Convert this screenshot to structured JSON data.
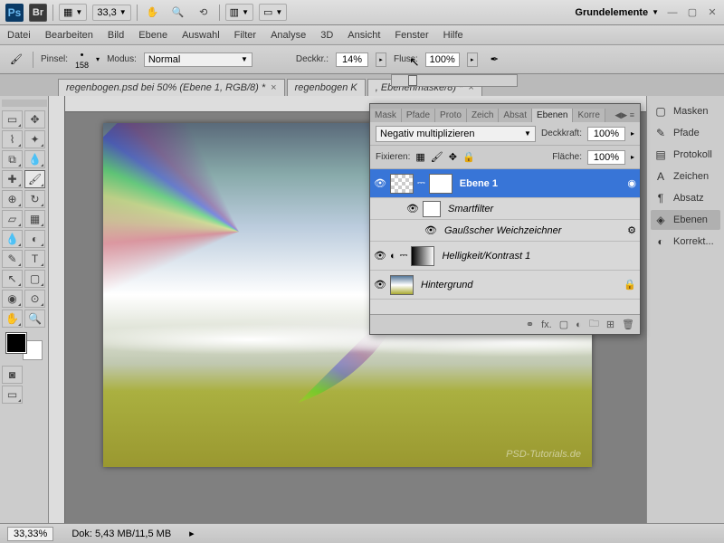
{
  "topbar": {
    "ps": "Ps",
    "br": "Br",
    "zoom_dd": "33,3",
    "workspace": "Grundelemente"
  },
  "menu": [
    "Datei",
    "Bearbeiten",
    "Bild",
    "Ebene",
    "Auswahl",
    "Filter",
    "Analyse",
    "3D",
    "Ansicht",
    "Fenster",
    "Hilfe"
  ],
  "options": {
    "brush_label": "Pinsel:",
    "brush_size": "158",
    "mode_label": "Modus:",
    "mode_value": "Normal",
    "opacity_label": "Deckkr.:",
    "opacity_value": "14%",
    "flow_label": "Fluss:",
    "flow_value": "100%"
  },
  "tabs": [
    {
      "title": "regenbogen.psd bei 50% (Ebene 1, RGB/8) *"
    },
    {
      "title": "regenbogen K"
    },
    {
      "title": ", Ebenenmaske/8) *"
    }
  ],
  "panel": {
    "tabs": [
      "Mask",
      "Pfade",
      "Proto",
      "Zeich",
      "Absat",
      "Ebenen",
      "Korre"
    ],
    "active_tab": 5,
    "blend_label": "",
    "blend_mode": "Negativ multiplizieren",
    "opacity_label": "Deckkraft:",
    "opacity_value": "100%",
    "lock_label": "Fixieren:",
    "fill_label": "Fläche:",
    "fill_value": "100%",
    "layers": [
      {
        "name": "Ebene 1",
        "selected": true,
        "eye": true
      },
      {
        "name": "Smartfilter",
        "sub": true,
        "eye": true
      },
      {
        "name": "Gaußscher Weichzeichner",
        "sub": true,
        "eye": true,
        "indent": 2
      },
      {
        "name": "Helligkeit/Kontrast 1",
        "eye": true
      },
      {
        "name": "Hintergrund",
        "eye": true,
        "locked": true
      }
    ]
  },
  "dock": [
    {
      "icon": "▢",
      "label": "Masken"
    },
    {
      "icon": "✎",
      "label": "Pfade"
    },
    {
      "icon": "▤",
      "label": "Protokoll"
    },
    {
      "icon": "A",
      "label": "Zeichen"
    },
    {
      "icon": "¶",
      "label": "Absatz"
    },
    {
      "icon": "◈",
      "label": "Ebenen",
      "active": true
    },
    {
      "icon": "◐",
      "label": "Korrekt..."
    }
  ],
  "status": {
    "zoom": "33,33%",
    "doc": "Dok: 5,43 MB/11,5 MB"
  },
  "watermark": "PSD-Tutorials.de"
}
